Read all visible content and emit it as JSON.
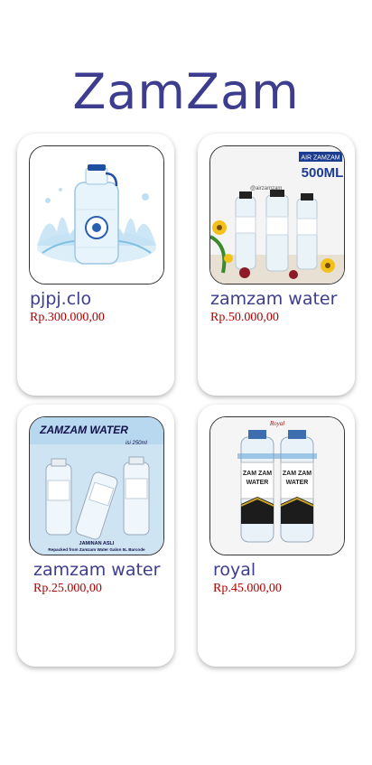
{
  "app": {
    "title": "ZamZam"
  },
  "products": [
    {
      "name": "pjpj.clo",
      "price": "Rp.300.000,00",
      "image": "water-gallon-splash-image"
    },
    {
      "name": "zamzam water",
      "price": "Rp.50.000,00",
      "image": "bottles-500ml-flowers-image",
      "badge_top": "AIR ZAMZAM",
      "badge_main": "500ML",
      "watermark": "@airzamzam"
    },
    {
      "name": "zamzam water",
      "price": "Rp.25.000,00",
      "image": "zamzam-water-poster-image",
      "poster_title": "ZAMZAM WATER",
      "poster_sub": "isi 250ml",
      "poster_footer1": "JAMINAN ASLI",
      "poster_footer2": "Repacked from Zamzam Water Galon 5L Barcode"
    },
    {
      "name": "royal",
      "price": "Rp.45.000,00",
      "image": "royal-zamzam-bottles-image",
      "label_line1": "ZAM ZAM",
      "label_line2": "WATER",
      "logo": "Royal"
    }
  ],
  "colors": {
    "title": "#3c3d8f",
    "price": "#b00000"
  }
}
